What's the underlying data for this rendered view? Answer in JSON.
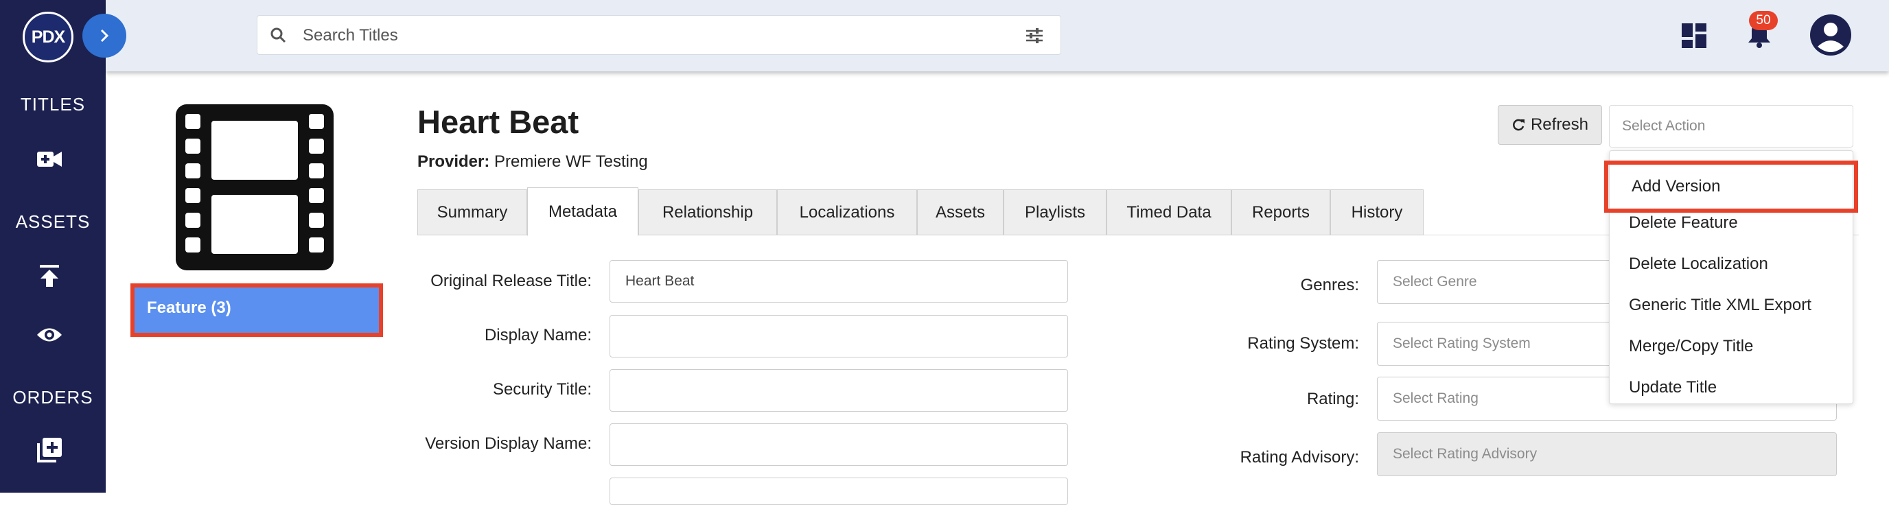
{
  "logo": {
    "text": "PDX"
  },
  "nav": {
    "titles_label": "TITLES",
    "assets_label": "ASSETS",
    "orders_label": "ORDERS"
  },
  "search": {
    "placeholder": "Search Titles"
  },
  "header": {
    "notification_count": "50"
  },
  "title": {
    "name": "Heart Beat",
    "provider_label": "Provider:",
    "provider_value": "Premiere WF Testing",
    "feature_badge": "Feature (3)"
  },
  "actions": {
    "refresh_label": "Refresh",
    "select_action_placeholder": "Select Action",
    "menu": [
      "Add Version",
      "Delete Feature",
      "Delete Localization",
      "Generic Title XML Export",
      "Merge/Copy Title",
      "Update Title"
    ]
  },
  "tabs": [
    "Summary",
    "Metadata",
    "Relationship",
    "Localizations",
    "Assets",
    "Playlists",
    "Timed Data",
    "Reports",
    "History"
  ],
  "active_tab": "Metadata",
  "form_left": {
    "original_release_title_label": "Original Release Title:",
    "original_release_title_value": "Heart Beat",
    "display_name_label": "Display Name:",
    "security_title_label": "Security Title:",
    "version_display_name_label": "Version Display Name:"
  },
  "form_right": {
    "genres_label": "Genres:",
    "genres_placeholder": "Select Genre",
    "rating_system_label": "Rating System:",
    "rating_system_placeholder": "Select Rating System",
    "rating_label": "Rating:",
    "rating_placeholder": "Select Rating",
    "rating_advisory_label": "Rating Advisory:",
    "rating_advisory_placeholder": "Select Rating Advisory"
  },
  "colors": {
    "nav_bg": "#1c2150",
    "accent_blue": "#2e6fd1",
    "highlight_red": "#e8412a",
    "badge_blue": "#5b90f0"
  }
}
